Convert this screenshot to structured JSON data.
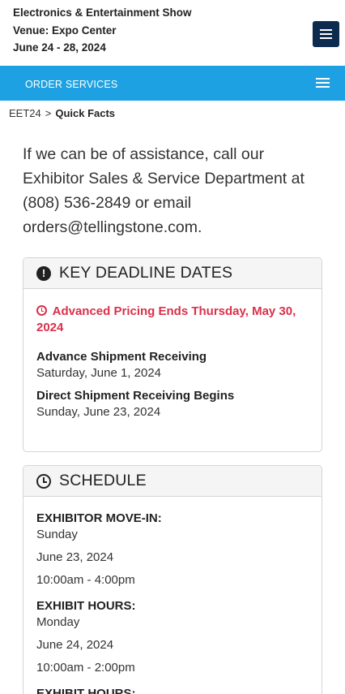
{
  "header": {
    "show_name": "Electronics & Entertainment Show",
    "venue": "Venue: Expo Center",
    "dates": "June 24 - 28, 2024"
  },
  "nav": {
    "order_services": "ORDER SERVICES"
  },
  "breadcrumb": {
    "root": "EET24",
    "separator": ">",
    "current": "Quick Facts"
  },
  "intro": {
    "text": "If we can be of assistance, call our Exhibitor Sales & Service Department at (808) 536-2849 or email orders@tellingstone.com."
  },
  "deadlines": {
    "title": "KEY DEADLINE DATES",
    "alert": "Advanced Pricing Ends Thursday, May 30, 2024",
    "items": [
      {
        "label": "Advance Shipment Receiving",
        "value": "Saturday, June 1, 2024"
      },
      {
        "label": "Direct Shipment Receiving Begins",
        "value": "Sunday, June 23, 2024"
      }
    ]
  },
  "schedule": {
    "title": "SCHEDULE",
    "groups": [
      {
        "label": "EXHIBITOR MOVE-IN:",
        "day": "Sunday",
        "date": "June 23, 2024",
        "time": "10:00am - 4:00pm"
      },
      {
        "label": "EXHIBIT HOURS:",
        "day": "Monday",
        "date": "June 24, 2024",
        "time": "10:00am - 2:00pm"
      },
      {
        "label": "EXHIBIT HOURS:"
      }
    ]
  },
  "colors": {
    "nav_bar": "#1da1e2",
    "menu_button": "#0d2b4e",
    "alert": "#d9304a"
  }
}
